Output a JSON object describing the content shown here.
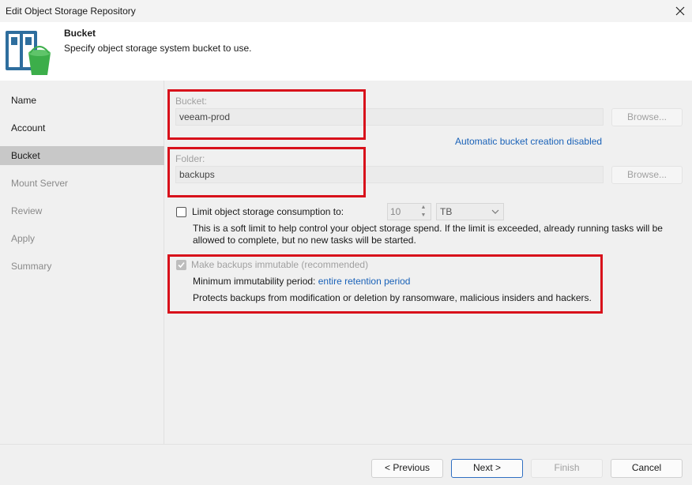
{
  "window": {
    "title": "Edit Object Storage Repository"
  },
  "header": {
    "title": "Bucket",
    "subtitle": "Specify object storage system bucket to use.",
    "icon": "bucket-repository-icon"
  },
  "sidebar": {
    "items": [
      {
        "label": "Name",
        "state": "normal"
      },
      {
        "label": "Account",
        "state": "normal"
      },
      {
        "label": "Bucket",
        "state": "active"
      },
      {
        "label": "Mount Server",
        "state": "disabled"
      },
      {
        "label": "Review",
        "state": "disabled"
      },
      {
        "label": "Apply",
        "state": "disabled"
      },
      {
        "label": "Summary",
        "state": "disabled"
      }
    ]
  },
  "bucket": {
    "label": "Bucket:",
    "value": "veeam-prod",
    "browse_label": "Browse...",
    "auto_creation_link": "Automatic bucket creation disabled"
  },
  "folder": {
    "label": "Folder:",
    "value": "backups",
    "browse_label": "Browse..."
  },
  "limit": {
    "label": "Limit object storage consumption to:",
    "checked": false,
    "value": "10",
    "unit": "TB",
    "description": "This is a soft limit to help control your object storage spend. If the limit is exceeded, already running tasks will be allowed to complete, but no new tasks will be started."
  },
  "immutable": {
    "label": "Make backups immutable (recommended)",
    "checked": true,
    "period_prefix": "Minimum immutability period:",
    "period_link": "entire retention period",
    "description": "Protects backups from modification or deletion by ransomware, malicious insiders and hackers."
  },
  "footer": {
    "previous": "< Previous",
    "next": "Next >",
    "finish": "Finish",
    "cancel": "Cancel"
  },
  "colors": {
    "highlight": "#d8111b",
    "link": "#1a62b8",
    "active_sidebar": "#c8c8c8"
  }
}
